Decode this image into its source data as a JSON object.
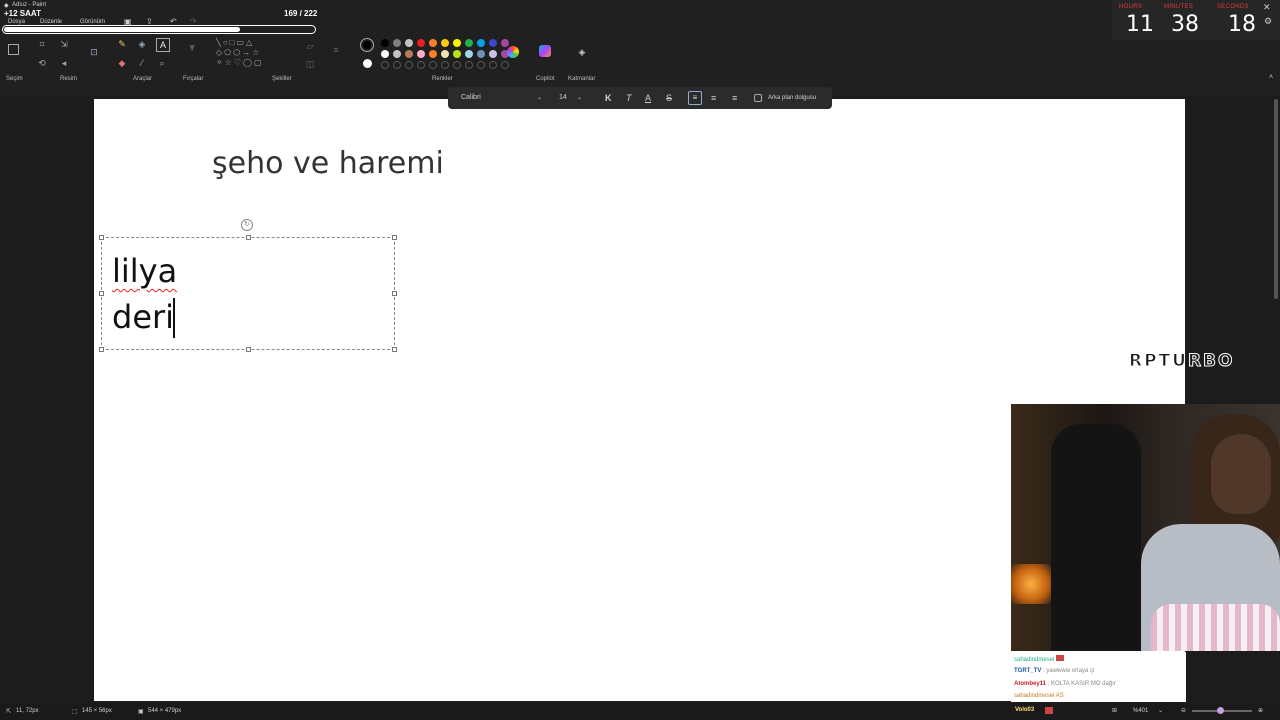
{
  "titlebar": {
    "app_title": "Adsız - Paint",
    "badge_text": "+12 SAAT",
    "menu": [
      "Dosya",
      "Düzenle",
      "Görünüm"
    ],
    "subathon_count": "169 / 222",
    "subathon_progress": 0.761
  },
  "timer": {
    "hours_label": "HOURS",
    "minutes_label": "MINUTES",
    "seconds_label": "SECONDS",
    "hours": "11",
    "minutes": "38",
    "seconds": "18"
  },
  "ribbon": {
    "groups": {
      "selection": "Seçim",
      "image": "Resim",
      "tools": "Araçlar",
      "brushes": "Fırçalar",
      "shapes": "Şekiller",
      "colors": "Renkler",
      "copilot": "Copilot",
      "layers": "Katmanlar"
    },
    "colors_row1": [
      "#000000",
      "#7f7f7f",
      "#c3c3c3",
      "#ed1c24",
      "#ff7f27",
      "#ffc90e",
      "#fff200",
      "#22b14c",
      "#00a2e8",
      "#3f48cc",
      "#a349a4"
    ],
    "colors_row2": [
      "#ffffff",
      "#c3c3c3",
      "#b97a57",
      "#ffaec9",
      "#ff7f27",
      "#efe4b0",
      "#b5e61d",
      "#99d9ea",
      "#7092be",
      "#c8bfe7",
      "#a349a4"
    ],
    "primary_color": "#000000",
    "secondary_color": "#ffffff"
  },
  "format_toolbar": {
    "font_family": "Calibri",
    "font_size": "14",
    "bold_label": "K",
    "italic_label": "T",
    "underline_label": "A",
    "strike_label": "S",
    "background_fill_label": "Arka plan dolgusu"
  },
  "canvas": {
    "title_text": "şeho ve haremi",
    "textbox_line1": "lilya",
    "textbox_line2": "deri"
  },
  "overlay": {
    "watermark": "RPTURBO"
  },
  "chat": {
    "lines": [
      {
        "user": "sahadindmesei",
        "text": ""
      },
      {
        "user": "TGRT_TV",
        "text": "yawwww ortaya çi"
      },
      {
        "user": "Atombey11",
        "text": "KOLTA KASIR MO dağır"
      },
      {
        "user": "sahadindmesei",
        "text": "AS"
      }
    ],
    "status_user": "Volo03"
  },
  "statusbar": {
    "cursor_pos": "11, 72px",
    "selection_size": "145 × 56px",
    "canvas_size": "544 × 479px",
    "zoom": "%401"
  }
}
